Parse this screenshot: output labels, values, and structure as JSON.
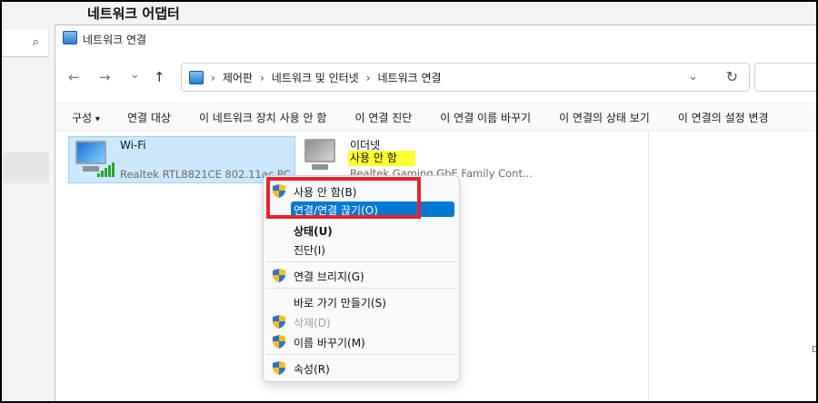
{
  "page": {
    "heading": "네트워크 어댑터"
  },
  "left_pane": {
    "search_icon": "⌕"
  },
  "window": {
    "title": "네트워크 연결",
    "nav": {
      "back": "←",
      "forward": "→",
      "history": "⌄",
      "up": "↑"
    },
    "address": {
      "crumbs": [
        "제어판",
        "네트워크 및 인터넷",
        "네트워크 연결"
      ],
      "separator": "›",
      "dropdown": "⌄",
      "refresh": "↻"
    },
    "commands": [
      {
        "label": "구성",
        "caret": "▾"
      },
      {
        "label": "연결 대상"
      },
      {
        "label": "이 네트워크 장치 사용 안 함"
      },
      {
        "label": "이 연결 진단"
      },
      {
        "label": "이 연결 이름 바꾸기"
      },
      {
        "label": "이 연결의 상태 보기"
      },
      {
        "label": "이 연결의 설정 변경"
      }
    ]
  },
  "adapters": {
    "wifi": {
      "name": "Wi-Fi",
      "device": "Realtek RTL8821CE 802.11ac PC..."
    },
    "ethernet": {
      "name": "이더넷",
      "status": "사용 안 함",
      "device": "Realtek Gaming GbE Family Cont..."
    }
  },
  "context_menu": {
    "items": {
      "disable": "사용 안 함(B)",
      "connect": "연결/연결 끊기(O)",
      "status": "상태(U)",
      "diagnose": "진단(I)",
      "bridge": "연결 브리지(G)",
      "shortcut": "바로 가기 만들기(S)",
      "delete": "삭제(D)",
      "rename": "이름 바꾸기(M)",
      "properties": "속성(R)"
    }
  },
  "edge": {
    "stray_char": "D"
  },
  "colors": {
    "highlight_blue": "#0078d4",
    "selection_bg": "#cce8ff",
    "annotation_red": "#e8232a",
    "marker_yellow": "#ffff33"
  }
}
